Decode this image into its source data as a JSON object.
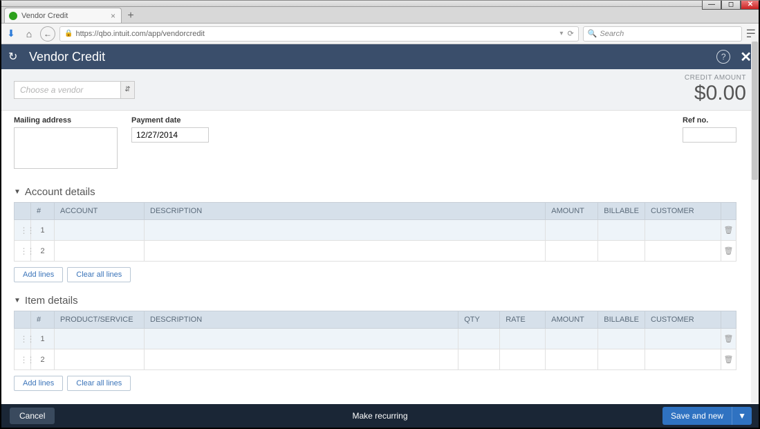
{
  "browser": {
    "tab_title": "Vendor Credit",
    "url": "https://qbo.intuit.com/app/vendorcredit",
    "search_placeholder": "Search"
  },
  "header": {
    "title": "Vendor Credit"
  },
  "vendor_select_placeholder": "Choose a vendor",
  "credit_amount": {
    "label": "CREDIT AMOUNT",
    "value": "$0.00"
  },
  "fields": {
    "mailing_label": "Mailing address",
    "payment_date_label": "Payment date",
    "payment_date_value": "12/27/2014",
    "ref_no_label": "Ref no."
  },
  "account_section": {
    "title": "Account details",
    "columns": {
      "num": "#",
      "account": "ACCOUNT",
      "description": "DESCRIPTION",
      "amount": "AMOUNT",
      "billable": "BILLABLE",
      "customer": "CUSTOMER"
    },
    "rows": [
      {
        "num": "1"
      },
      {
        "num": "2"
      }
    ]
  },
  "item_section": {
    "title": "Item details",
    "columns": {
      "num": "#",
      "product": "PRODUCT/SERVICE",
      "description": "DESCRIPTION",
      "qty": "QTY",
      "rate": "RATE",
      "amount": "AMOUNT",
      "billable": "BILLABLE",
      "customer": "CUSTOMER"
    },
    "rows": [
      {
        "num": "1"
      },
      {
        "num": "2"
      }
    ]
  },
  "buttons": {
    "add_lines": "Add lines",
    "clear_lines": "Clear all lines"
  },
  "footer": {
    "cancel": "Cancel",
    "recurring": "Make recurring",
    "save_new": "Save and new"
  }
}
